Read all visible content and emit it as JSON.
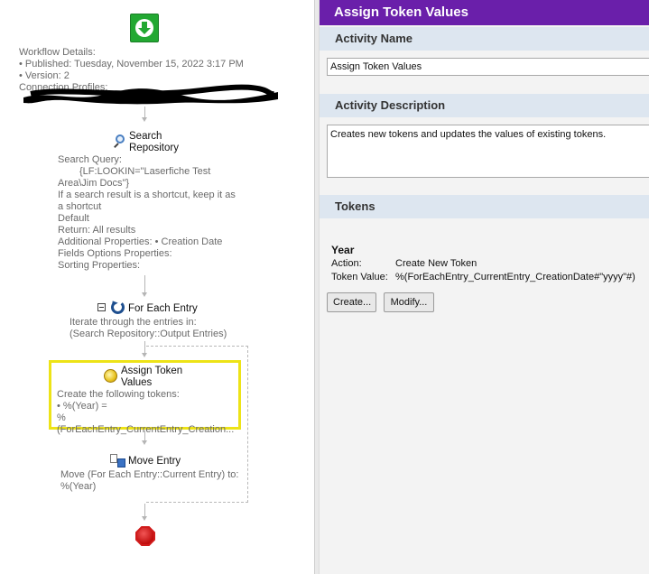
{
  "designer": {
    "details": {
      "heading": "Workflow Details:",
      "published": "• Published: Tuesday, November 15, 2022 3:17 PM",
      "version": "• Version: 2",
      "connection_profiles": "Connection Profiles:"
    },
    "activities": {
      "search": {
        "title_line1": "Search",
        "title_line2": "Repository",
        "lines": [
          "Search Query:",
          "{LF:LOOKIN=\"Laserfiche Test",
          "Area\\Jim Docs\"}",
          "If a search result is a shortcut, keep it as",
          "a shortcut",
          "Default",
          "Return: All results",
          "Additional Properties: • Creation Date",
          "Fields Options Properties:",
          "Sorting Properties:"
        ]
      },
      "for_each": {
        "title": "For Each Entry",
        "lines": [
          "Iterate through the entries in:",
          "(Search Repository::Output Entries)"
        ]
      },
      "assign": {
        "title_line1": "Assign Token",
        "title_line2": "Values",
        "lines": [
          "Create the following tokens:",
          "• %(Year) =",
          "%(ForEachEntry_CurrentEntry_Creation..."
        ]
      },
      "move": {
        "title": "Move Entry",
        "lines": [
          "Move (For Each Entry::Current Entry) to:",
          "%(Year)"
        ]
      }
    }
  },
  "props": {
    "header_title": "Assign Token Values",
    "activity_name": {
      "section_label": "Activity Name",
      "value": "Assign Token Values"
    },
    "activity_description": {
      "section_label": "Activity Description",
      "value": "Creates new tokens and updates the values of existing tokens."
    },
    "tokens": {
      "section_label": "Tokens",
      "items": [
        {
          "name": "Year",
          "action_label": "Action:",
          "action_value": "Create New Token",
          "value_label": "Token Value:",
          "value_value": "%(ForEachEntry_CurrentEntry_CreationDate#\"yyyy\"#)"
        }
      ],
      "create_button": "Create...",
      "modify_button": "Modify..."
    }
  },
  "colors": {
    "header_purple": "#6a1faa",
    "section_bg": "#dde6f0",
    "selection_yellow": "#ede317",
    "start_green": "#22a832",
    "stop_red": "#d11b1b"
  }
}
